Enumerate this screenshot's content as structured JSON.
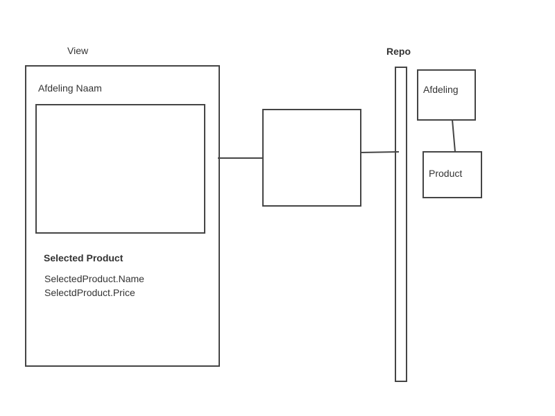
{
  "view": {
    "caption": "View",
    "department_name_label": "Afdeling Naam",
    "selected_product_heading": "Selected Product",
    "selected_product_name": "SelectedProduct.Name",
    "selected_product_price": "SelectdProduct.Price"
  },
  "repo": {
    "caption": "Repo",
    "entity_department": "Afdeling",
    "entity_product": "Product"
  },
  "colors": {
    "stroke": "#444444",
    "text": "#333333",
    "background": "#ffffff"
  }
}
